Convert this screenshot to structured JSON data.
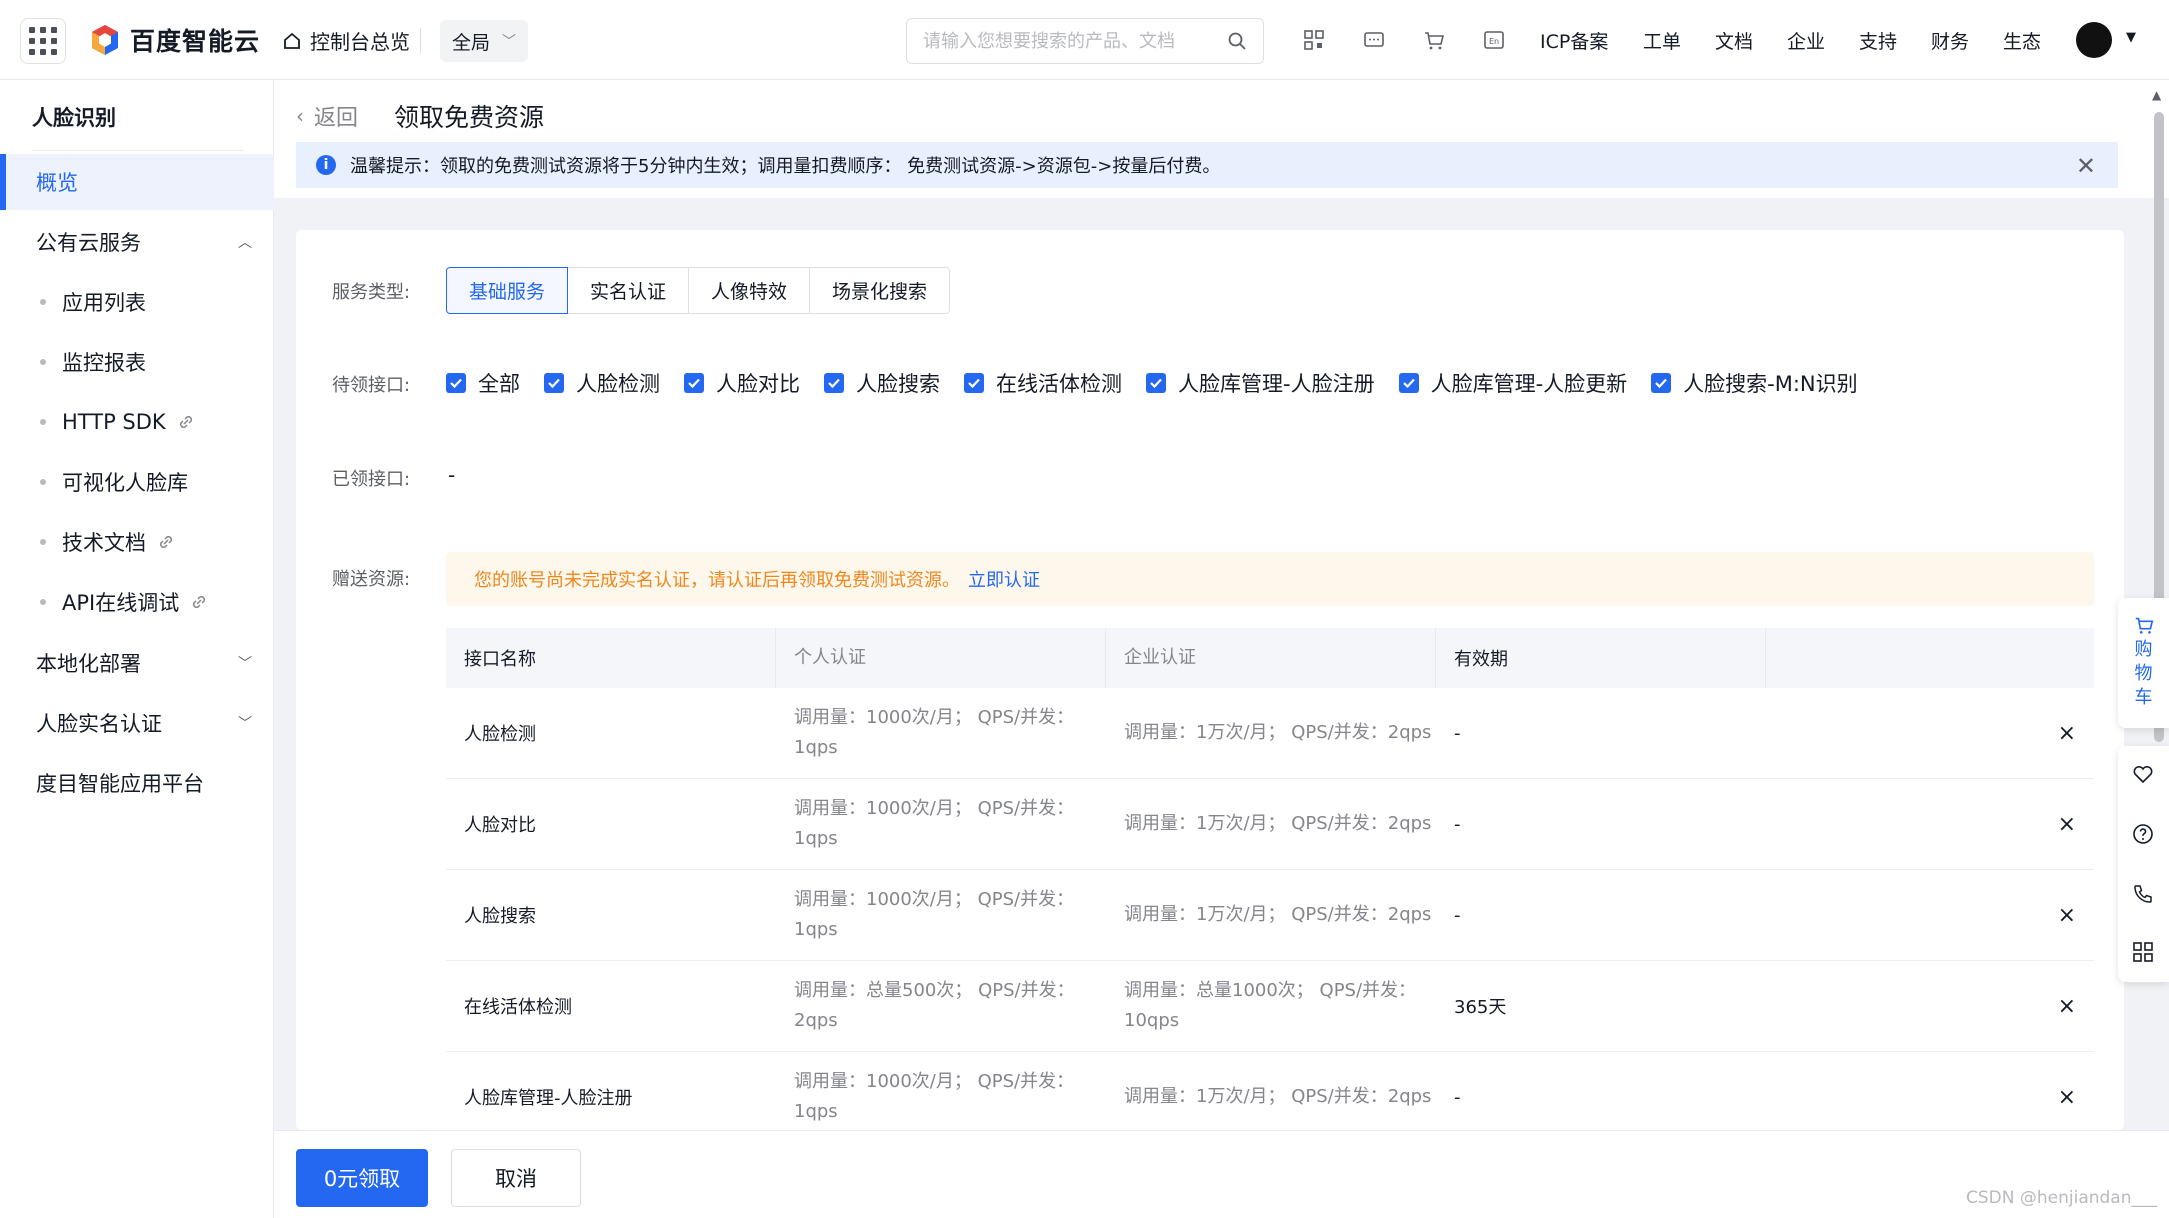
{
  "topbar": {
    "brand": "百度智能云",
    "home": "控制台总览",
    "region": "全局",
    "search_placeholder": "请输入您想要搜索的产品、文档",
    "nav": [
      "ICP备案",
      "工单",
      "文档",
      "企业",
      "支持",
      "财务",
      "生态"
    ]
  },
  "sidebar": {
    "title": "人脸识别",
    "items": [
      {
        "label": "概览"
      },
      {
        "label": "公有云服务"
      },
      {
        "label": "应用列表"
      },
      {
        "label": "监控报表"
      },
      {
        "label": "HTTP SDK"
      },
      {
        "label": "可视化人脸库"
      },
      {
        "label": "技术文档"
      },
      {
        "label": "API在线调试"
      },
      {
        "label": "本地化部署"
      },
      {
        "label": "人脸实名认证"
      },
      {
        "label": "度目智能应用平台"
      }
    ]
  },
  "header": {
    "back": "返回",
    "title": "领取免费资源",
    "notice": "温馨提示：领取的免费测试资源将于5分钟内生效；调用量扣费顺序： 免费测试资源->资源包->按量后付费。"
  },
  "form": {
    "service_type_label": "服务类型:",
    "tabs": [
      "基础服务",
      "实名认证",
      "人像特效",
      "场景化搜索"
    ],
    "pending_label": "待领接口:",
    "checkboxes": [
      "全部",
      "人脸检测",
      "人脸对比",
      "人脸搜索",
      "在线活体检测",
      "人脸库管理-人脸注册",
      "人脸库管理-人脸更新",
      "人脸搜索-M:N识别"
    ],
    "claimed_label": "已领接口:",
    "claimed_value": "-",
    "gift_label": "赠送资源:",
    "warning": "您的账号尚未完成实名认证，请认证后再领取免费测试资源。",
    "warning_link": "立即认证"
  },
  "table": {
    "headers": [
      "接口名称",
      "个人认证",
      "企业认证",
      "有效期",
      ""
    ],
    "rows": [
      {
        "name": "人脸检测",
        "personal": "调用量：1000次/月； QPS/并发：1qps",
        "enterprise": "调用量：1万次/月； QPS/并发：2qps",
        "validity": "-"
      },
      {
        "name": "人脸对比",
        "personal": "调用量：1000次/月； QPS/并发：1qps",
        "enterprise": "调用量：1万次/月； QPS/并发：2qps",
        "validity": "-"
      },
      {
        "name": "人脸搜索",
        "personal": "调用量：1000次/月； QPS/并发：1qps",
        "enterprise": "调用量：1万次/月； QPS/并发：2qps",
        "validity": "-"
      },
      {
        "name": "在线活体检测",
        "personal": "调用量：总量500次； QPS/并发：2qps",
        "enterprise": "调用量：总量1000次； QPS/并发：10qps",
        "validity": "365天"
      },
      {
        "name": "人脸库管理-人脸注册",
        "personal": "调用量：1000次/月； QPS/并发：1qps",
        "enterprise": "调用量：1万次/月； QPS/并发：2qps",
        "validity": "-"
      }
    ]
  },
  "footer": {
    "claim": "0元领取",
    "cancel": "取消",
    "watermark": "CSDN @henjiandan___"
  },
  "float": {
    "cart": [
      "购",
      "物",
      "车"
    ]
  },
  "colors": {
    "primary": "#2468f2",
    "warning": "#f0871d",
    "notice_bg": "#e9f0fd"
  }
}
